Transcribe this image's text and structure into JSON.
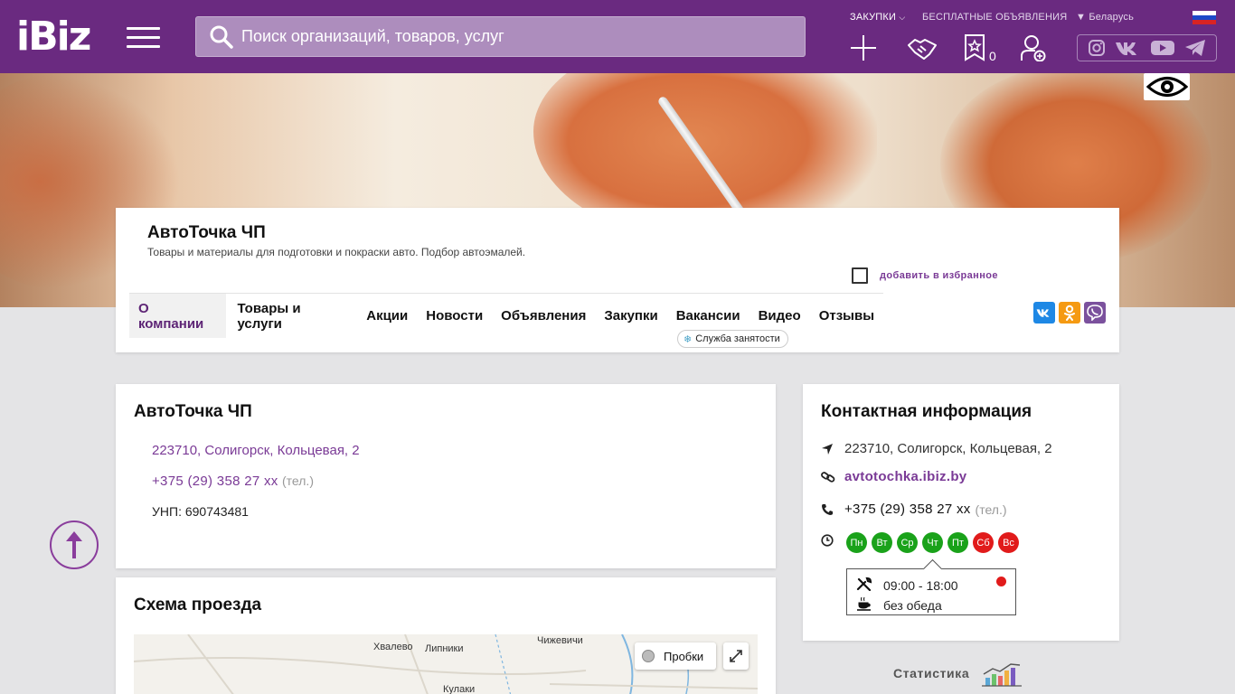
{
  "header": {
    "logo": "iBiz",
    "search_placeholder": "Поиск организаций, товаров, услуг",
    "purchases": "ЗАКУПКИ",
    "free_ads": "БЕСПЛАТНЫЕ ОБЪЯВЛЕНИЯ",
    "region": "Беларусь",
    "favorites_count": "0"
  },
  "company": {
    "name": "АвтоТочка ЧП",
    "description": "Товары и материалы для подготовки и покраски авто. Подбор автоэмалей.",
    "add_favorite": "добавить в избранное"
  },
  "tabs": [
    {
      "label": "О компании",
      "active": true
    },
    {
      "label": "Товары и услуги"
    },
    {
      "label": "Акции"
    },
    {
      "label": "Новости"
    },
    {
      "label": "Объявления"
    },
    {
      "label": "Закупки"
    },
    {
      "label": "Вакансии"
    },
    {
      "label": "Видео"
    },
    {
      "label": "Отзывы"
    }
  ],
  "vacancy_badge": "Служба занятости",
  "about": {
    "title": "АвтоТочка ЧП",
    "address": "223710, Солигорск, Кольцевая, 2",
    "phone": "+375 (29) 358 27 xx",
    "phone_hint": "(тел.)",
    "unp": "УНП: 690743481"
  },
  "route": {
    "title": "Схема проезда",
    "traffic": "Пробки",
    "places": [
      "Хвалево",
      "Липники",
      "Чижевичи",
      "Кулаки"
    ]
  },
  "contacts": {
    "title": "Контактная информация",
    "address": "223710, Солигорск, Кольцевая, 2",
    "website": "avtotochka.ibiz.by",
    "phone": "+375 (29) 358 27 xx",
    "phone_hint": "(тел.)",
    "days": [
      {
        "label": "Пн",
        "status": "open"
      },
      {
        "label": "Вт",
        "status": "open"
      },
      {
        "label": "Ср",
        "status": "open"
      },
      {
        "label": "Чт",
        "status": "open"
      },
      {
        "label": "Пт",
        "status": "open"
      },
      {
        "label": "Сб",
        "status": "closed"
      },
      {
        "label": "Вс",
        "status": "closed"
      }
    ],
    "hours": "09:00 - 18:00",
    "lunch": "без обеда"
  },
  "stats_label": "Статистика",
  "colors": {
    "brand": "#6a2a80",
    "accent_link": "#7a3a96",
    "open": "#1aa21a",
    "closed": "#e11b1b",
    "vk": "#1e88e5",
    "ok": "#f59a12",
    "viber": "#7b519d"
  }
}
